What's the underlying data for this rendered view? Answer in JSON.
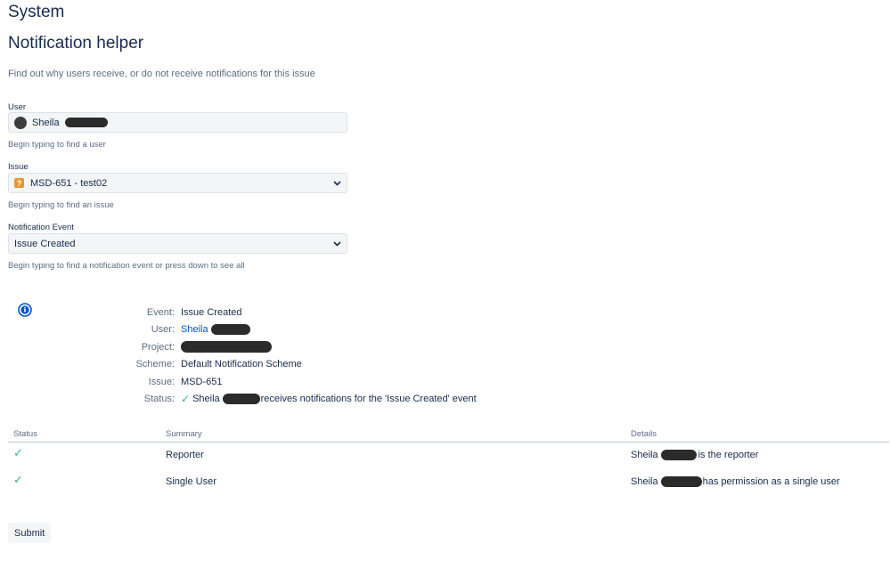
{
  "page": {
    "title": "System"
  },
  "section": {
    "title": "Notification helper",
    "description": "Find out why users receive, or do not receive notifications for this issue"
  },
  "form": {
    "user": {
      "label": "User",
      "value": "Sheila",
      "help": "Begin typing to find a user"
    },
    "issue": {
      "label": "Issue",
      "value": "MSD-651 - test02",
      "help": "Begin typing to find an issue"
    },
    "event": {
      "label": "Notification Event",
      "value": "Issue Created",
      "help": "Begin typing to find a notification event or press down to see all"
    }
  },
  "info": {
    "event": {
      "key": "Event:",
      "value": "Issue Created"
    },
    "user": {
      "key": "User:",
      "value": "Sheila"
    },
    "project": {
      "key": "Project:",
      "value": ""
    },
    "scheme": {
      "key": "Scheme:",
      "value": "Default Notification Scheme"
    },
    "issue": {
      "key": "Issue:",
      "value": "MSD-651"
    },
    "status": {
      "key": "Status:",
      "name": "Sheila",
      "text": "receives notifications for the 'Issue Created' event"
    }
  },
  "results": {
    "headers": {
      "status": "Status",
      "summary": "Summary",
      "details": "Details"
    },
    "rows": [
      {
        "summary": "Reporter",
        "details_name": "Sheila",
        "details_text": "is the reporter"
      },
      {
        "summary": "Single User",
        "details_name": "Sheila",
        "details_text": "has permission as a single user"
      }
    ]
  },
  "buttons": {
    "submit": "Submit"
  },
  "colors": {
    "link": "#0052cc",
    "check": "#36b37e",
    "issue_icon": "#e8962e"
  }
}
